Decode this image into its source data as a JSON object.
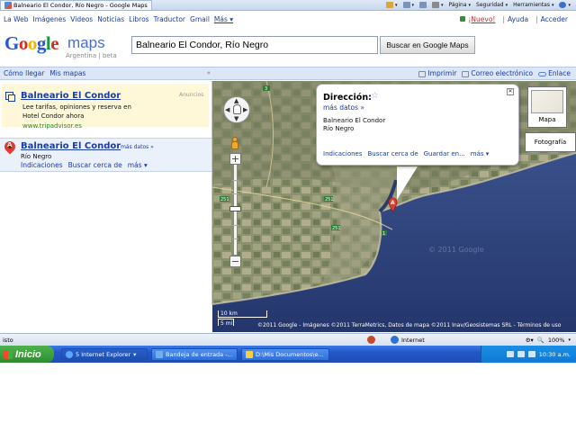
{
  "browser": {
    "tab_title": "Balneario El Condor, Río Negro - Google Maps",
    "commands": [
      "Página",
      "Seguridad",
      "Herramientas"
    ]
  },
  "gbar": {
    "links": [
      "La Web",
      "Imágenes",
      "Videos",
      "Noticias",
      "Libros",
      "Traductor",
      "Gmail"
    ],
    "more": "Más ▾",
    "new": "¡Nuevo!",
    "help": "Ayuda",
    "signin": "Acceder"
  },
  "logo": {
    "g1": "G",
    "o1": "o",
    "o2": "o",
    "g2": "g",
    "l": "l",
    "e": "e",
    "maps": "maps",
    "sub": "Argentina | beta"
  },
  "search": {
    "value": "Balneario El Condor, Río Negro",
    "button": "Buscar en Google Maps"
  },
  "toolbar": {
    "directions": "Cómo llegar",
    "my_maps": "Mis mapas",
    "collapse": "«",
    "print": "Imprimir",
    "email": "Correo electrónico",
    "link": "Enlace"
  },
  "ad": {
    "title": "Balneario El Condor",
    "label": "Anuncios",
    "line1": "Lee tarifas, opiniones y reserva en",
    "line2": "Hotel Condor ahora",
    "url": "www.tripadvisor.es"
  },
  "result": {
    "marker": "A",
    "title": "Balneario El Condor",
    "more": "- más datos »",
    "address": "Río Negro",
    "links": [
      "Indicaciones",
      "Buscar cerca de",
      "más ▾"
    ]
  },
  "infowindow": {
    "title": "Dirección:",
    "more": "más datos »",
    "address1": "Balneario El Condor",
    "address2": "Río Negro",
    "links": [
      "Indicaciones",
      "Buscar cerca de",
      "Guardar en...",
      "más ▾"
    ],
    "close": "✕"
  },
  "map": {
    "type_map": "Mapa",
    "type_photo": "Fotografía",
    "marker": "A",
    "scale_km": "10 km",
    "scale_mi": "5 mi",
    "copyright": "©2011 Google - Imágenes ©2011 TerraMetrics, Datos de mapa ©2011 Inav/Geosistemas SRL - Términos de uso",
    "road_labels": [
      "3",
      "251",
      "251",
      "251",
      "1"
    ],
    "watermark": "© 2011 Google",
    "colors": {
      "land": "#8a8f6b",
      "sea": "#2c3f77"
    }
  },
  "statusbar": {
    "left": "isto",
    "zone": "Internet",
    "zoom": "100%"
  },
  "taskbar": {
    "start": "Inicio",
    "tasks": [
      "5 Internet Explorer",
      "Bandeja de entrada -...",
      "D:\\Mis Documentos\\e..."
    ],
    "clock": "10:30 a.m."
  }
}
